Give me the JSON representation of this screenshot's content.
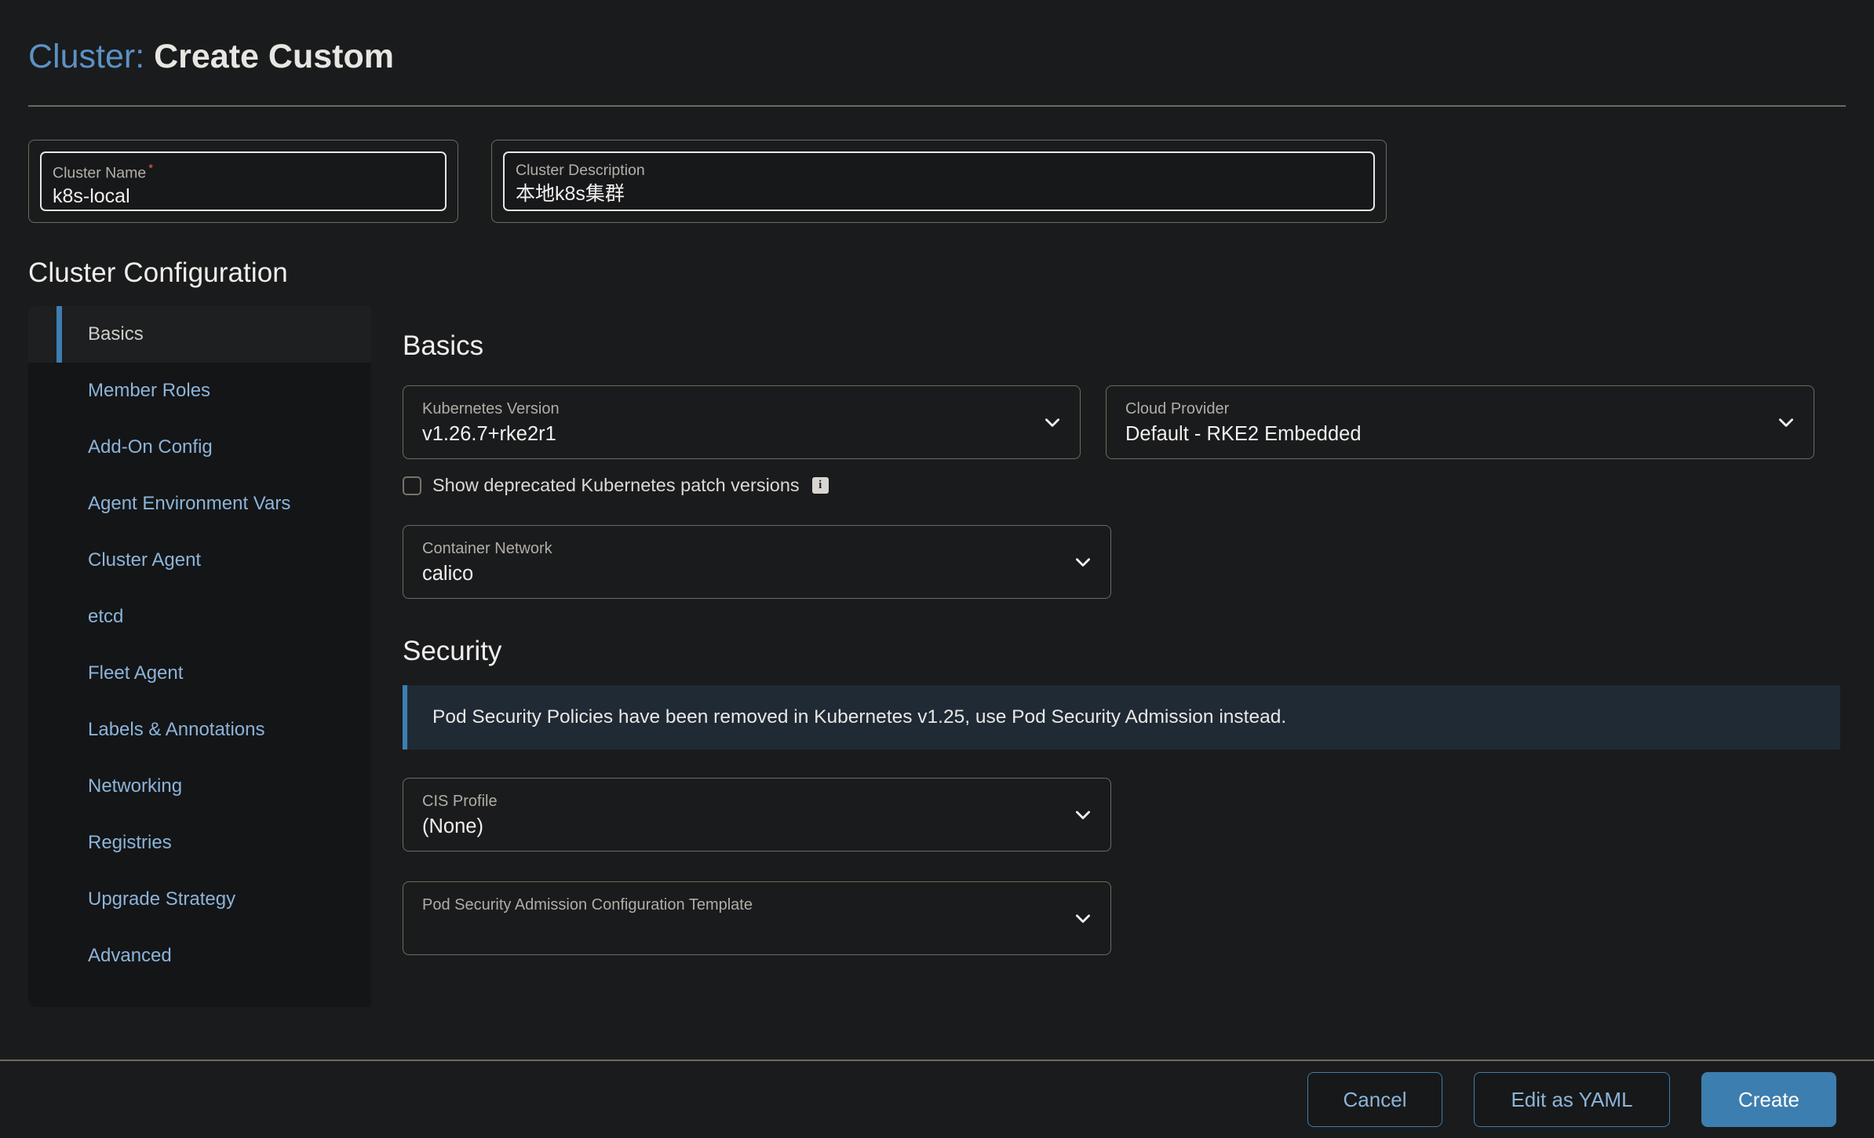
{
  "header": {
    "title_prefix": "Cluster:",
    "title_suffix": "Create Custom"
  },
  "cluster_name_field": {
    "label": "Cluster Name",
    "required_marker": "*",
    "value": "k8s-local"
  },
  "cluster_description_field": {
    "label": "Cluster Description",
    "value": "本地k8s集群"
  },
  "cluster_configuration": {
    "heading": "Cluster Configuration",
    "sidebar": {
      "items": [
        {
          "label": "Basics",
          "active": true
        },
        {
          "label": "Member Roles",
          "active": false
        },
        {
          "label": "Add-On Config",
          "active": false
        },
        {
          "label": "Agent Environment Vars",
          "active": false
        },
        {
          "label": "Cluster Agent",
          "active": false
        },
        {
          "label": "etcd",
          "active": false
        },
        {
          "label": "Fleet Agent",
          "active": false
        },
        {
          "label": "Labels & Annotations",
          "active": false
        },
        {
          "label": "Networking",
          "active": false
        },
        {
          "label": "Registries",
          "active": false
        },
        {
          "label": "Upgrade Strategy",
          "active": false
        },
        {
          "label": "Advanced",
          "active": false
        }
      ]
    },
    "basics": {
      "heading": "Basics",
      "kubernetes_version": {
        "label": "Kubernetes Version",
        "value": "v1.26.7+rke2r1"
      },
      "cloud_provider": {
        "label": "Cloud Provider",
        "value": "Default - RKE2 Embedded"
      },
      "show_deprecated": {
        "label": "Show deprecated Kubernetes patch versions",
        "checked": false,
        "info_glyph": "i"
      },
      "container_network": {
        "label": "Container Network",
        "value": "calico"
      }
    },
    "security": {
      "heading": "Security",
      "banner_text": "Pod Security Policies have been removed in Kubernetes v1.25, use Pod Security Admission instead.",
      "cis_profile": {
        "label": "CIS Profile",
        "value": "(None)"
      },
      "psa_template": {
        "label": "Pod Security Admission Configuration Template",
        "value": ""
      }
    }
  },
  "footer": {
    "cancel_label": "Cancel",
    "yaml_label": "Edit as YAML",
    "create_label": "Create"
  },
  "colors": {
    "page_bg": "#1a1b1c",
    "accent_blue": "#3d7eb0",
    "link_blue": "#8cb4d9",
    "border_tan": "#6f6a60",
    "required_red": "#e0654f",
    "banner_bg": "#1f2a35"
  }
}
